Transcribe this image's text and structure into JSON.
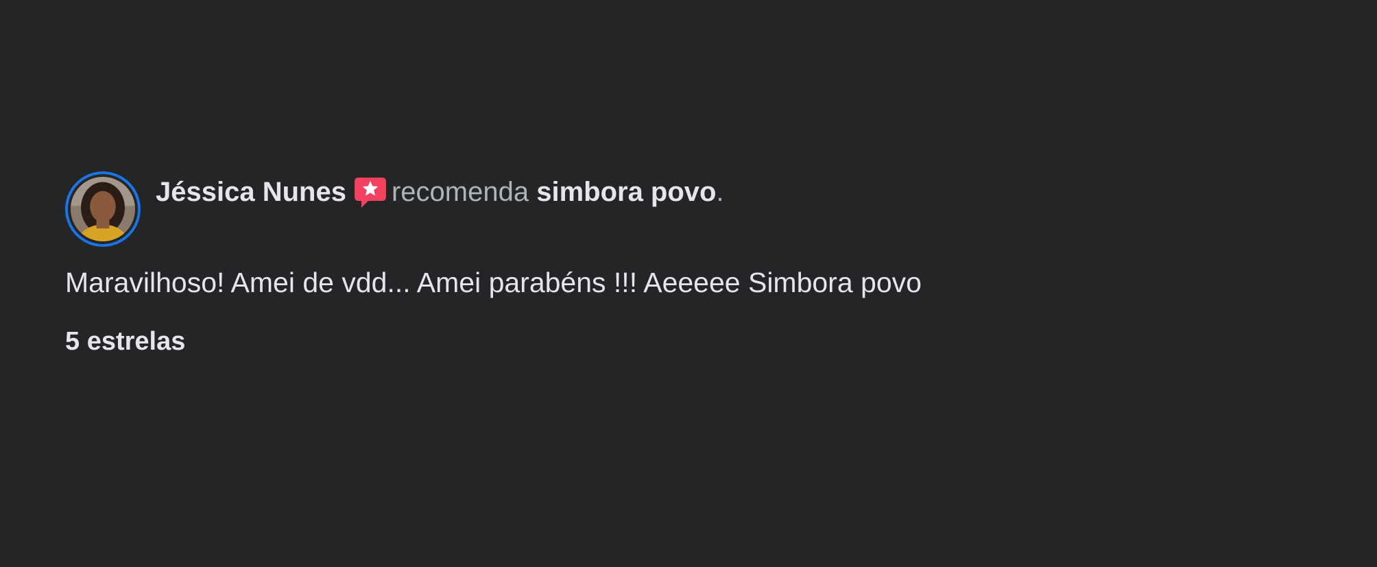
{
  "review": {
    "author_name": "Jéssica Nunes",
    "verb": "recomenda",
    "page_name": "simbora povo",
    "trailing_punct": ".",
    "text": "Maravilhoso! Amei de vdd... Amei parabéns !!! Aeeeee Simbora povo",
    "rating_label": "5 estrelas",
    "recommend_icon": "recommend-star-bubble-icon"
  },
  "colors": {
    "background": "#242526",
    "primary_text": "#e4e6eb",
    "secondary_text": "#b0b3b8",
    "avatar_ring": "#1b74e4",
    "recommend_icon": "#f3425f"
  }
}
